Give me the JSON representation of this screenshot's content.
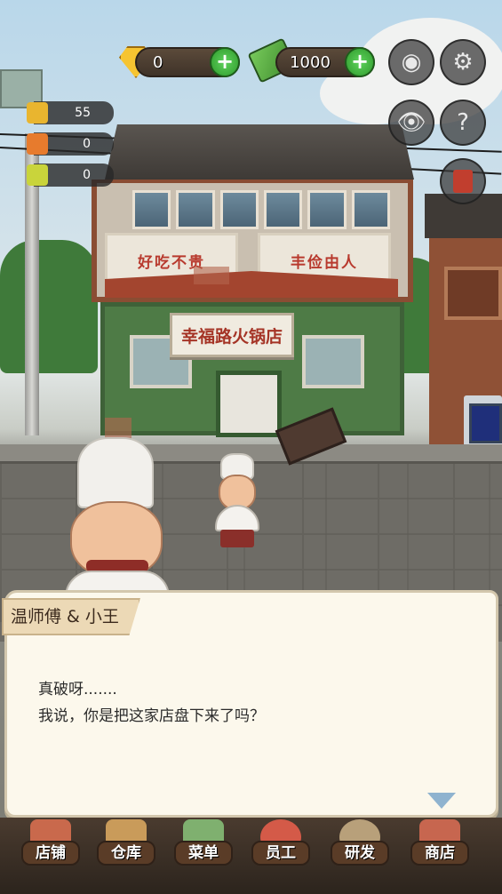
{
  "hud": {
    "gems": "0",
    "cash": "1000",
    "resources": [
      "55",
      "0",
      "0"
    ]
  },
  "shop": {
    "banner_left": "好吃不贵",
    "banner_right": "丰俭由人",
    "signboard": "幸福路火锅店"
  },
  "dialog": {
    "speaker": "温师傅 & 小王",
    "line1": "真破呀.......",
    "line2": "我说，你是把这家店盘下来了吗？"
  },
  "nav": {
    "items": [
      {
        "label": "店铺",
        "icon": "storefront-icon"
      },
      {
        "label": "仓库",
        "icon": "crate-icon"
      },
      {
        "label": "菜单",
        "icon": "menu-board-icon"
      },
      {
        "label": "员工",
        "icon": "staff-icon"
      },
      {
        "label": "研发",
        "icon": "research-icon"
      },
      {
        "label": "商店",
        "icon": "shop-icon"
      }
    ]
  },
  "colors": {
    "accent_green": "#3fae3b",
    "shop_red": "#b83a2e",
    "dialog_bg": "#fcf8ec",
    "nav_label_bg": "#5a3c27"
  }
}
